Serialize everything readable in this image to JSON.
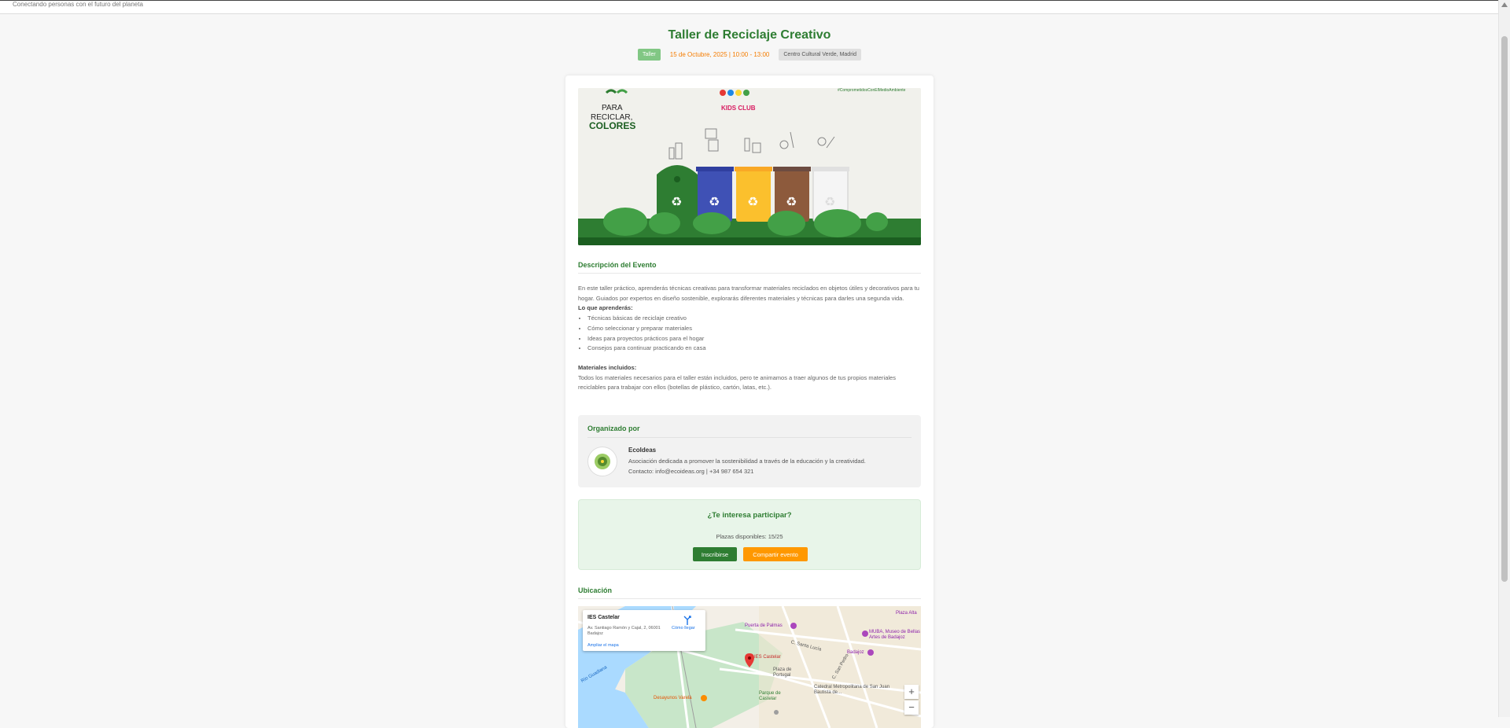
{
  "header": {
    "tagline": "Conectando personas con el futuro del planeta"
  },
  "event": {
    "title": "Taller de Reciclaje Creativo",
    "category": "Taller",
    "datetime": "15 de Octubre, 2025 | 10:00 - 13:00",
    "venue": "Centro Cultural Verde, Madrid"
  },
  "hero": {
    "title_line1": "PARA",
    "title_line2": "RECICLAR,",
    "title_line3": "COLORES",
    "brand": "KIDS CLUB",
    "hashtag": "#ComprometidosConElMedioAmbiente",
    "bin_colors": [
      "#2e7d32",
      "#3f51b5",
      "#fbc02d",
      "#8d5a3c",
      "#eeeeee"
    ]
  },
  "description": {
    "heading": "Descripción del Evento",
    "intro": "En este taller práctico, aprenderás técnicas creativas para transformar materiales reciclados en objetos útiles y decorativos para tu hogar. Guiados por expertos en diseño sostenible, explorarás diferentes materiales y técnicas para darles una segunda vida.",
    "learn_heading": "Lo que aprenderás:",
    "learn_items": [
      "Técnicas básicas de reciclaje creativo",
      "Cómo seleccionar y preparar materiales",
      "Ideas para proyectos prácticos para el hogar",
      "Consejos para continuar practicando en casa"
    ],
    "materials_heading": "Materiales incluidos:",
    "materials_text": "Todos los materiales necesarios para el taller están incluidos, pero te animamos a traer algunos de tus propios materiales reciclables para trabajar con ellos (botellas de plástico, cartón, latas, etc.)."
  },
  "organizer": {
    "heading": "Organizado por",
    "name": "EcoIdeas",
    "description": "Asociación dedicada a promover la sostenibilidad a través de la educación y la creatividad.",
    "contact": "Contacto: info@ecoideas.org | +34 987 654 321"
  },
  "cta": {
    "heading": "¿Te interesa participar?",
    "seats": "Plazas disponibles: 15/25",
    "join_label": "Inscribirse",
    "share_label": "Compartir evento"
  },
  "location": {
    "heading": "Ubicación",
    "place": "IES Castelar",
    "address": "Av. Santiago Ramón y Cajal, 2, 06001 Badajoz",
    "enlarge": "Ampliar el mapa",
    "directions": "Cómo llegar",
    "map_labels": {
      "pin": "IES Castelar",
      "muba": "MUBA, Museo de Bellas Artes de Badajoz",
      "badajoz": "Badajoz",
      "puerta": "Puerta de Palmas",
      "plaza_portugal": "Plaza de Portugal",
      "parque": "Parque de Castelar",
      "catedral": "Catedral Metropolitana de San Juan Bautista de...",
      "plaza_alta": "Plaza Alta",
      "guadiana": "Río Guadiana",
      "deportivo": "Desayunos Varelà",
      "street_corte": "C. Santa Lucía",
      "street_obispo": "C. San Pedro"
    },
    "zoom_in": "+",
    "zoom_out": "−"
  }
}
